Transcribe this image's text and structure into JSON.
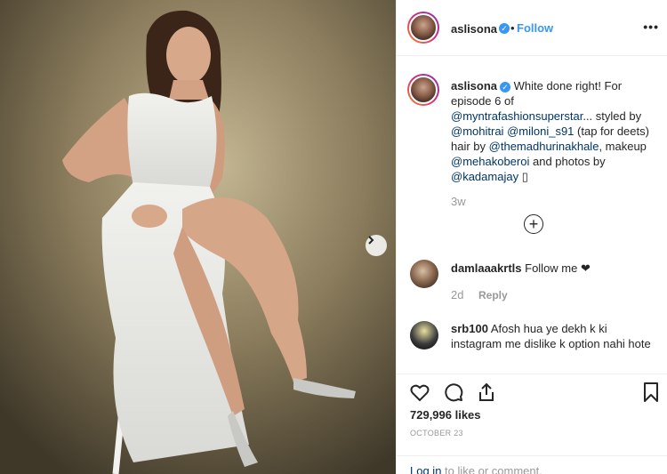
{
  "post": {
    "username": "aslisona",
    "follow_label": "Follow",
    "separator": "•",
    "more_label": "•••"
  },
  "caption": {
    "username": "aslisona",
    "text_1": "White done right! For episode 6 of",
    "mention_1": "@myntrafashionsuperstar",
    "text_2": "... styled by",
    "mention_2": "@mohitrai",
    "mention_3": "@miloni_s91",
    "text_3": "(tap for deets) hair by",
    "mention_4": "@themadhurinakhale",
    "text_4": ", makeup",
    "mention_5": "@mehakoberoi",
    "text_5": "and photos by",
    "mention_6": "@kadamajay",
    "trailing": "▯",
    "time": "3w"
  },
  "load_more_symbol": "+",
  "comments": [
    {
      "username": "damlaaakrtls",
      "text": "Follow me ❤",
      "time": "2d",
      "reply": "Reply"
    },
    {
      "username": "srb100",
      "text": "Afosh hua ye dekh k ki instagram me dislike k option nahi hote"
    }
  ],
  "likes": "729,996 likes",
  "date": "OCTOBER 23",
  "footer": {
    "login_link": "Log in",
    "text": "to like or comment."
  },
  "icons": {
    "heart": "heart-icon",
    "comment": "comment-icon",
    "share": "share-icon",
    "save": "bookmark-icon",
    "next": "chevron-right-icon",
    "verified": "verified-badge-icon"
  },
  "colors": {
    "link_blue": "#3897f0",
    "mention": "#003569",
    "muted": "#999999",
    "text": "#262626"
  }
}
